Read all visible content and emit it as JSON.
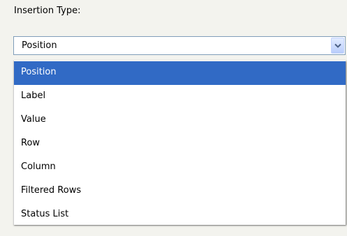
{
  "insertion_type": {
    "label": "Insertion Type:",
    "selected_value": "Position",
    "dropdown_icon": "chevron-down-icon",
    "accent_color": "#316ac5",
    "options": [
      {
        "label": "Position",
        "selected": true
      },
      {
        "label": "Label",
        "selected": false
      },
      {
        "label": "Value",
        "selected": false
      },
      {
        "label": "Row",
        "selected": false
      },
      {
        "label": "Column",
        "selected": false
      },
      {
        "label": "Filtered Rows",
        "selected": false
      },
      {
        "label": "Status List",
        "selected": false
      }
    ]
  }
}
